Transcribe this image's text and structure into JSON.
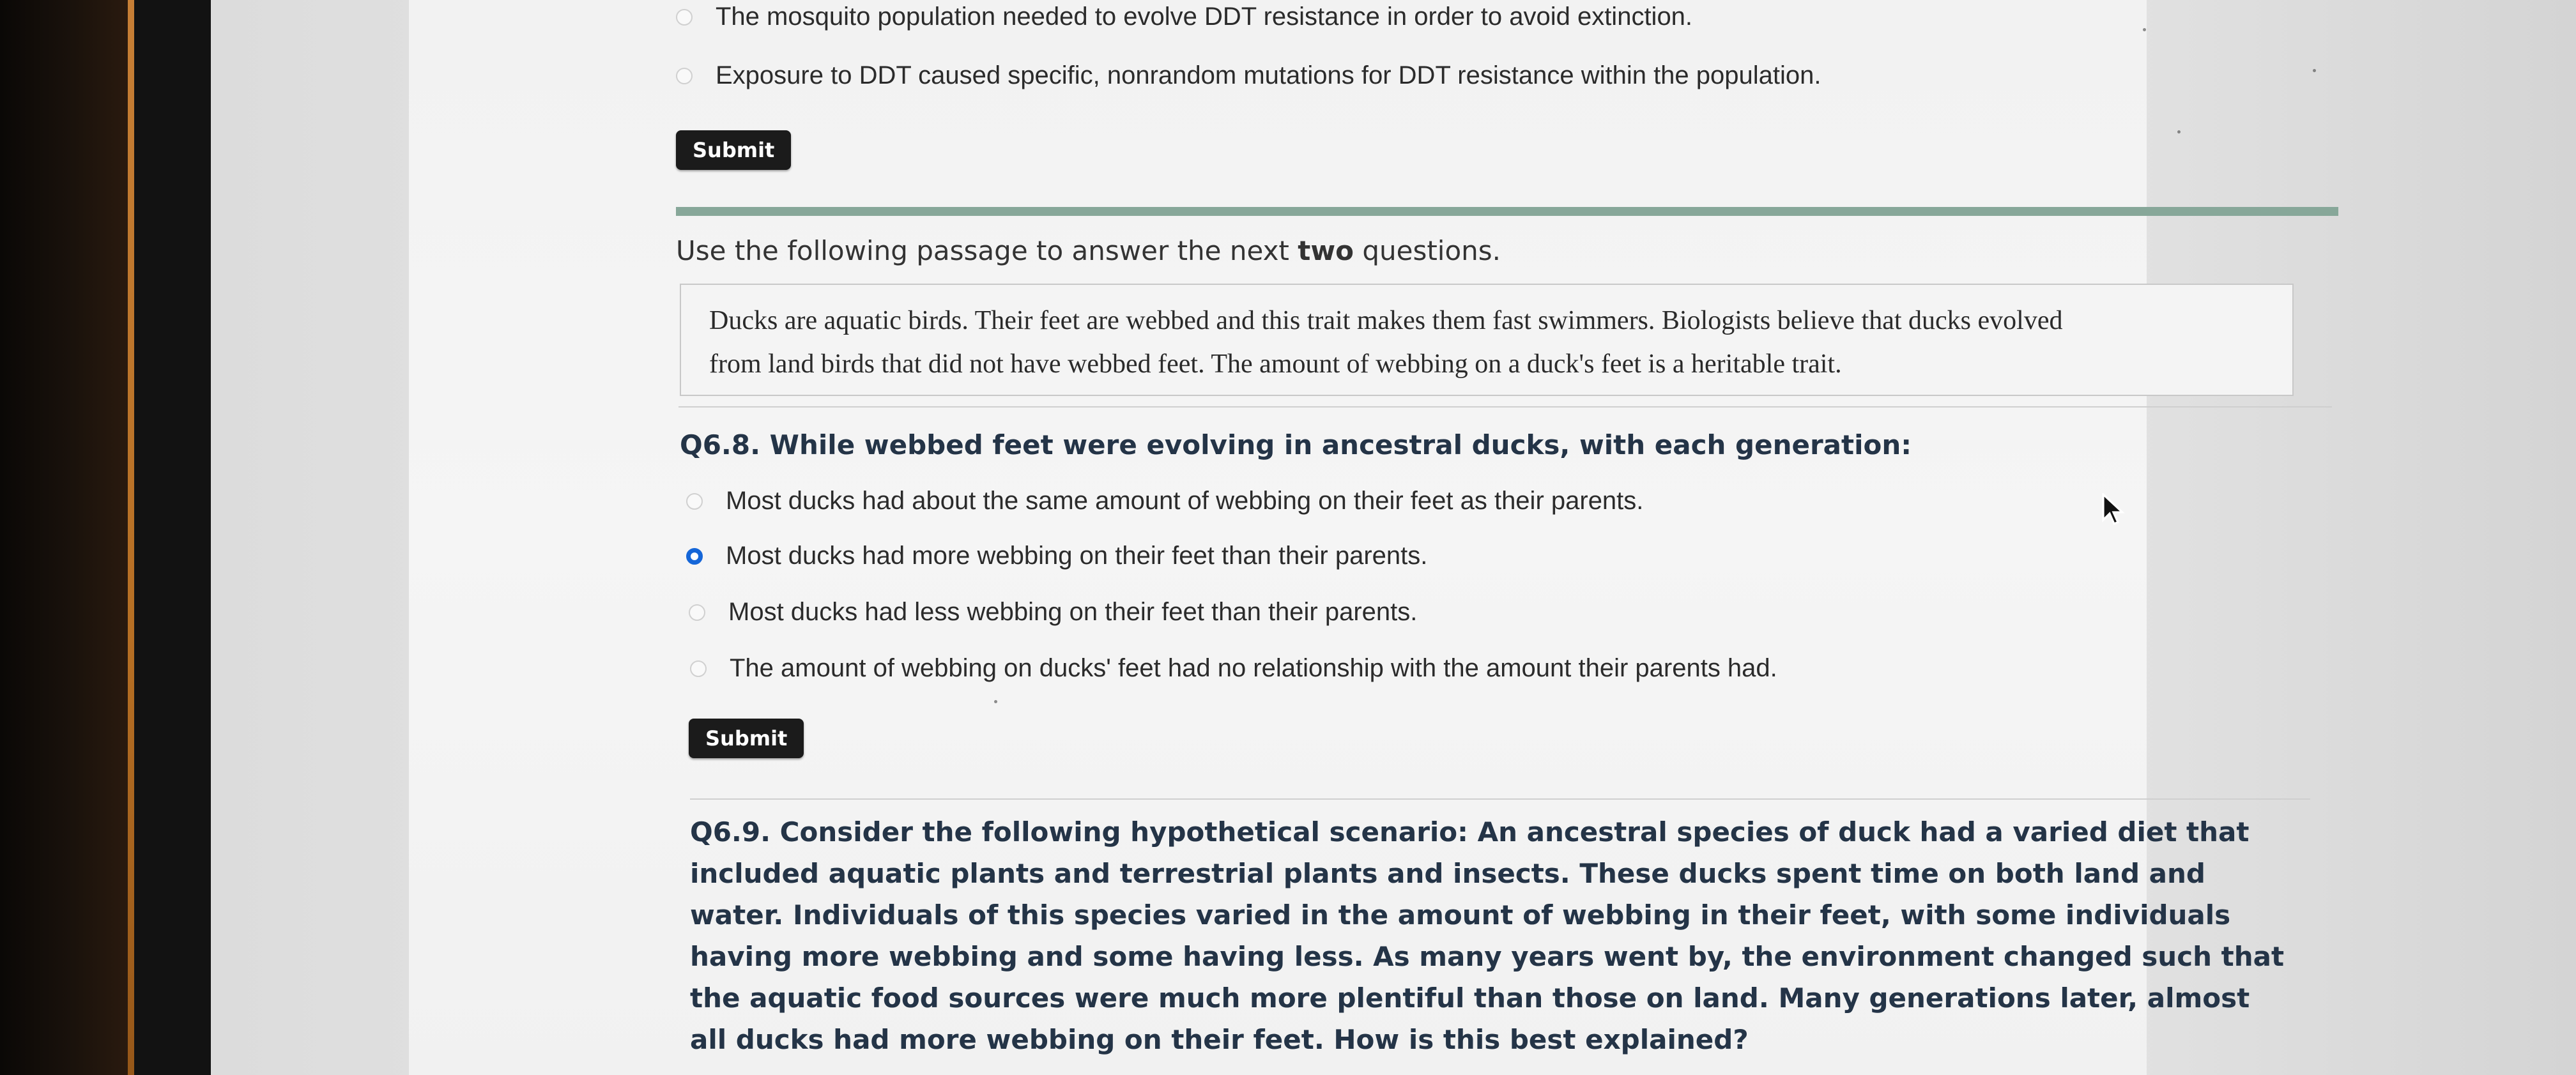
{
  "top_question": {
    "options": [
      {
        "label": "The mosquito population needed to evolve DDT resistance in order to avoid extinction.",
        "selected": false
      },
      {
        "label": "Exposure to DDT caused specific, nonrandom mutations for DDT resistance within the population.",
        "selected": false
      }
    ],
    "submit_label": "Submit"
  },
  "passage_section": {
    "intro_before": "Use the following passage to answer the next ",
    "intro_bold": "two",
    "intro_after": " questions.",
    "passage_line1": "Ducks are aquatic birds. Their feet are webbed and this trait makes them fast swimmers. Biologists believe that ducks evolved",
    "passage_line2": "from land birds that did not have webbed feet. The amount of webbing on a duck's feet is a heritable trait."
  },
  "q68": {
    "question": "Q6.8. While webbed feet were evolving in ancestral ducks, with each generation:",
    "options": [
      {
        "label": "Most ducks had about the same amount of webbing on their feet as their parents.",
        "selected": false
      },
      {
        "label": "Most ducks had more webbing on their feet than their parents.",
        "selected": true
      },
      {
        "label": "Most ducks had less webbing on their feet than their parents.",
        "selected": false
      },
      {
        "label": "The amount of webbing on ducks' feet had no relationship with the amount their parents had.",
        "selected": false
      }
    ],
    "submit_label": "Submit"
  },
  "q69": {
    "question": "Q6.9. Consider the following hypothetical scenario: An ancestral species of duck had a varied diet that included aquatic plants and terrestrial plants and insects. These ducks spent time on both land and water. Individuals of this species varied in the amount of webbing in their feet, with some individuals having more webbing and some having less. As many years went by, the environment changed such that the aquatic food sources were much more plentiful than those on land. Many generations later, almost all ducks had more webbing on their feet. How is this best explained?"
  },
  "colors": {
    "radio_selected": "#1566d8",
    "section_divider": "#87a799",
    "button_bg": "#1b1b1b",
    "question_text": "#243447"
  }
}
